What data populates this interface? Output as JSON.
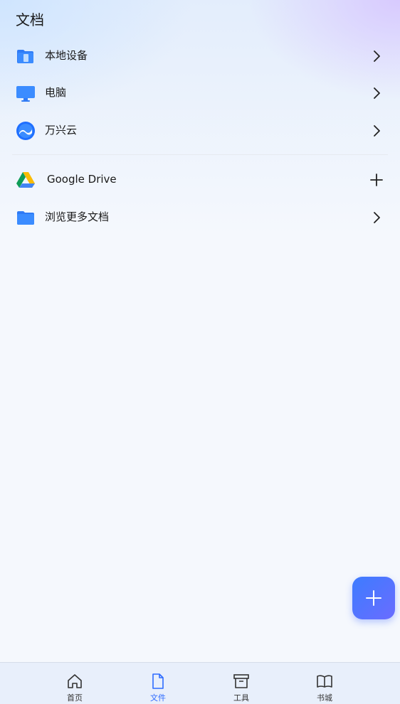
{
  "header": {
    "title": "文档"
  },
  "locations": [
    {
      "label": "本地设备",
      "icon": "phone-storage-icon",
      "trail": "chevron-right-icon"
    },
    {
      "label": "电脑",
      "icon": "monitor-icon",
      "trail": "chevron-right-icon"
    },
    {
      "label": "万兴云",
      "icon": "cloud-icon",
      "trail": "chevron-right-icon"
    }
  ],
  "services": [
    {
      "label": "Google Drive",
      "icon": "google-drive-icon",
      "trail": "plus-icon"
    },
    {
      "label": "浏览更多文档",
      "icon": "folder-icon",
      "trail": "chevron-right-icon"
    }
  ],
  "fab": {
    "icon": "plus-icon"
  },
  "bottom_nav": [
    {
      "label": "首页",
      "icon": "home-icon",
      "active": false
    },
    {
      "label": "文件",
      "icon": "file-icon",
      "active": true
    },
    {
      "label": "工具",
      "icon": "toolbox-icon",
      "active": false
    },
    {
      "label": "书城",
      "icon": "book-icon",
      "active": false
    }
  ],
  "colors": {
    "accent": "#2e6bff",
    "fab_gradient_end": "#6a6cff"
  }
}
